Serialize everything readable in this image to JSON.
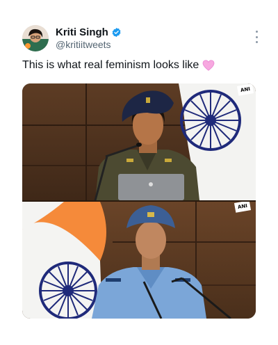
{
  "tweet": {
    "display_name": "Kriti Singh",
    "handle": "@kritiitweets",
    "text": "This is what real feminism looks like",
    "icons": [
      "avatar",
      "verified-badge-icon",
      "more-options-icon",
      "pink-heart-icon"
    ],
    "colors": {
      "verified": "#1d9bf0",
      "heart": "#f7a8e0",
      "handle": "#536471"
    }
  },
  "media": {
    "watermark_top": "ANI",
    "watermark_bottom": "ANI"
  }
}
